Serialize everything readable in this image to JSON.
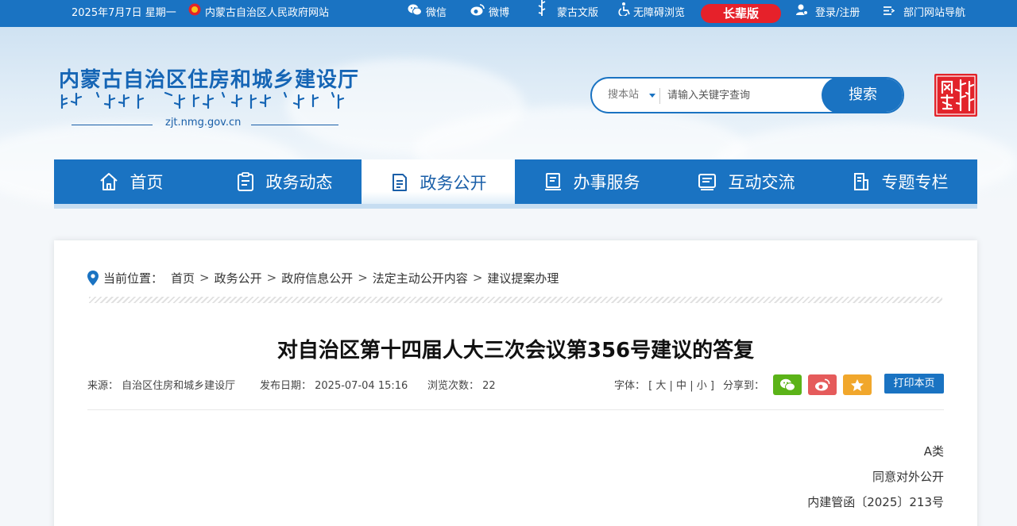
{
  "topbar": {
    "date": "2025年7月7日 星期一",
    "gov_link": "内蒙古自治区人民政府网站",
    "wechat": "微信",
    "weibo": "微博",
    "mongol_version": "蒙古文版",
    "accessible": "无障碍浏览",
    "elder_version": "长辈版",
    "login": "登录/注册",
    "dept_nav": "部门网站导航"
  },
  "header": {
    "site_name": "内蒙古自治区住房和城乡建设厅",
    "site_url": "zjt.nmg.gov.cn",
    "search_scope": "搜本站",
    "search_placeholder": "请输入关键字查询",
    "search_button": "搜索"
  },
  "nav": [
    {
      "label": "首页",
      "icon": "home-icon"
    },
    {
      "label": "政务动态",
      "icon": "clipboard-icon"
    },
    {
      "label": "政务公开",
      "icon": "document-icon"
    },
    {
      "label": "办事服务",
      "icon": "service-icon"
    },
    {
      "label": "互动交流",
      "icon": "chat-icon"
    },
    {
      "label": "专题专栏",
      "icon": "topic-icon"
    }
  ],
  "breadcrumb": {
    "label": "当前位置：",
    "items": [
      "首页",
      "政务公开",
      "政府信息公开",
      "法定主动公开内容",
      "建议提案办理"
    ]
  },
  "article": {
    "title": "对自治区第十四届人大三次会议第356号建议的答复",
    "source": "来源：  自治区住房和城乡建设厅",
    "publish_date": "发布日期：  2025-07-04 15:16",
    "views": "浏览次数：  22",
    "font_label": "字体：",
    "font_large": "大",
    "font_medium": "中",
    "font_small": "小",
    "share_label": "分享到：",
    "print_button": "打印本页",
    "doc_lines": [
      "A类",
      "同意对外公开",
      "内建管函〔2025〕213号"
    ]
  },
  "colors": {
    "primary": "#1a73c2",
    "elder_red": "#e6212a",
    "wechat_green": "#5bb318",
    "weibo_red": "#e55b5b",
    "favorite_orange": "#f1a72c"
  }
}
